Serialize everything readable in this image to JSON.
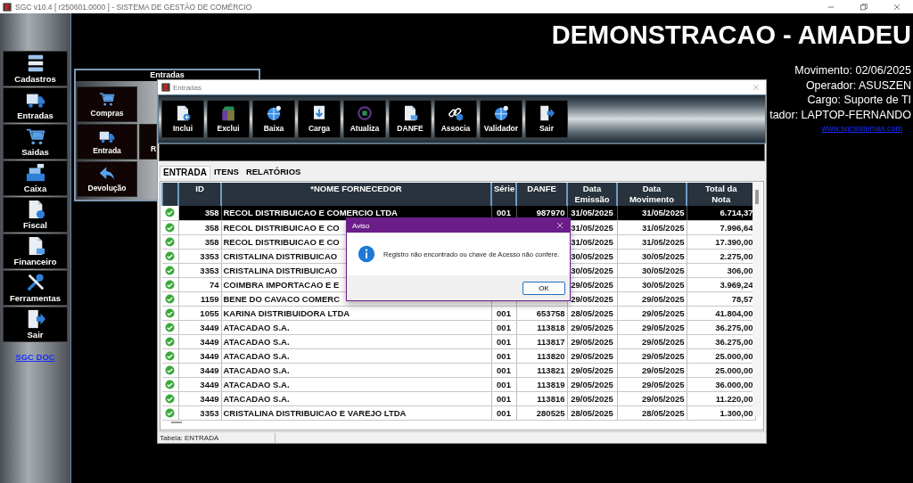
{
  "window": {
    "title": "SGC v10.4 [ r250601.0000 ] - SISTEMA DE GESTÃO DE COMÉRCIO"
  },
  "sidebar": {
    "items": [
      {
        "label": "Cadastros"
      },
      {
        "label": "Entradas"
      },
      {
        "label": "Saidas"
      },
      {
        "label": "Caixa"
      },
      {
        "label": "Fiscal"
      },
      {
        "label": "Financeiro"
      },
      {
        "label": "Ferramentas"
      },
      {
        "label": "Sair"
      }
    ],
    "link": "SGC DOC"
  },
  "header": {
    "title": "DEMONSTRACAO - AMADEU",
    "info": [
      "Movimento: 02/06/2025",
      "Operador: ASUSZEN",
      "Cargo: Suporte de TI",
      "tador: LAPTOP-FERNANDO"
    ],
    "link": "www.sgcsistemas.com"
  },
  "submenu": {
    "title": "Entradas",
    "buttons": [
      {
        "label": "Compras"
      },
      {
        "label": "Entrada"
      },
      {
        "label": "R"
      },
      {
        "label": "Devolução"
      }
    ]
  },
  "entradas_window": {
    "title": "Entradas",
    "toolbar": [
      "Inclui",
      "Exclui",
      "Baixa",
      "Carga",
      "Atualiza",
      "DANFE",
      "Associa",
      "Validador",
      "Sair"
    ],
    "tabs": [
      {
        "label": "ENTRADA",
        "selected": true
      },
      {
        "label": "ITENS",
        "selected": false
      },
      {
        "label": "RELATÓRIOS",
        "selected": false
      }
    ],
    "table": {
      "columns": [
        "ID",
        "*NOME FORNECEDOR",
        "Série",
        "DANFE",
        "Data\nEmissão",
        "Data\nMovimento",
        "Total da\nNota"
      ],
      "rows": [
        {
          "selected": true,
          "cells": [
            "358",
            "RECOL DISTRIBUICAO E COMERCIO LTDA",
            "001",
            "987970",
            "31/05/2025",
            "31/05/2025",
            "6.714,37"
          ]
        },
        {
          "selected": false,
          "cells": [
            "358",
            "RECOL DISTRIBUICAO E CO",
            null,
            null,
            "31/05/2025",
            "31/05/2025",
            "7.996,64"
          ]
        },
        {
          "selected": false,
          "cells": [
            "358",
            "RECOL DISTRIBUICAO E CO",
            null,
            null,
            "31/05/2025",
            "31/05/2025",
            "17.390,00"
          ]
        },
        {
          "selected": false,
          "cells": [
            "3353",
            "CRISTALINA DISTRIBUICAO",
            null,
            null,
            "30/05/2025",
            "30/05/2025",
            "2.275,00"
          ]
        },
        {
          "selected": false,
          "cells": [
            "3353",
            "CRISTALINA DISTRIBUICAO",
            null,
            null,
            "30/05/2025",
            "30/05/2025",
            "306,00"
          ]
        },
        {
          "selected": false,
          "cells": [
            "74",
            "COIMBRA IMPORTACAO E E",
            null,
            null,
            "29/05/2025",
            "30/05/2025",
            "3.969,24"
          ]
        },
        {
          "selected": false,
          "cells": [
            "1159",
            "BENE DO CAVACO COMERC",
            null,
            null,
            "29/05/2025",
            "29/05/2025",
            "78,57"
          ]
        },
        {
          "selected": false,
          "cells": [
            "1055",
            "KARINA DISTRIBUIDORA LTDA",
            "001",
            "653758",
            "28/05/2025",
            "29/05/2025",
            "41.804,00"
          ]
        },
        {
          "selected": false,
          "cells": [
            "3449",
            "ATACADAO S.A.",
            "001",
            "113818",
            "29/05/2025",
            "29/05/2025",
            "36.275,00"
          ]
        },
        {
          "selected": false,
          "cells": [
            "3449",
            "ATACADAO S.A.",
            "001",
            "113817",
            "29/05/2025",
            "29/05/2025",
            "36.275,00"
          ]
        },
        {
          "selected": false,
          "cells": [
            "3449",
            "ATACADAO S.A.",
            "001",
            "113820",
            "29/05/2025",
            "29/05/2025",
            "25.000,00"
          ]
        },
        {
          "selected": false,
          "cells": [
            "3449",
            "ATACADAO S.A.",
            "001",
            "113821",
            "29/05/2025",
            "29/05/2025",
            "25.000,00"
          ]
        },
        {
          "selected": false,
          "cells": [
            "3449",
            "ATACADAO S.A.",
            "001",
            "113819",
            "29/05/2025",
            "29/05/2025",
            "36.000,00"
          ]
        },
        {
          "selected": false,
          "cells": [
            "3449",
            "ATACADAO S.A.",
            "001",
            "113816",
            "29/05/2025",
            "29/05/2025",
            "11.220,00"
          ]
        },
        {
          "selected": false,
          "cells": [
            "3353",
            "CRISTALINA DISTRIBUICAO E VAREJO LTDA",
            "001",
            "280525",
            "28/05/2025",
            "28/05/2025",
            "1.300,00"
          ]
        }
      ]
    },
    "status_bar": "Tabela: ENTRADA"
  },
  "dialog": {
    "title": "Aviso",
    "message": "Registro não encontrado ou chave de Acesso não confere.",
    "buttons": [
      "OK"
    ]
  }
}
